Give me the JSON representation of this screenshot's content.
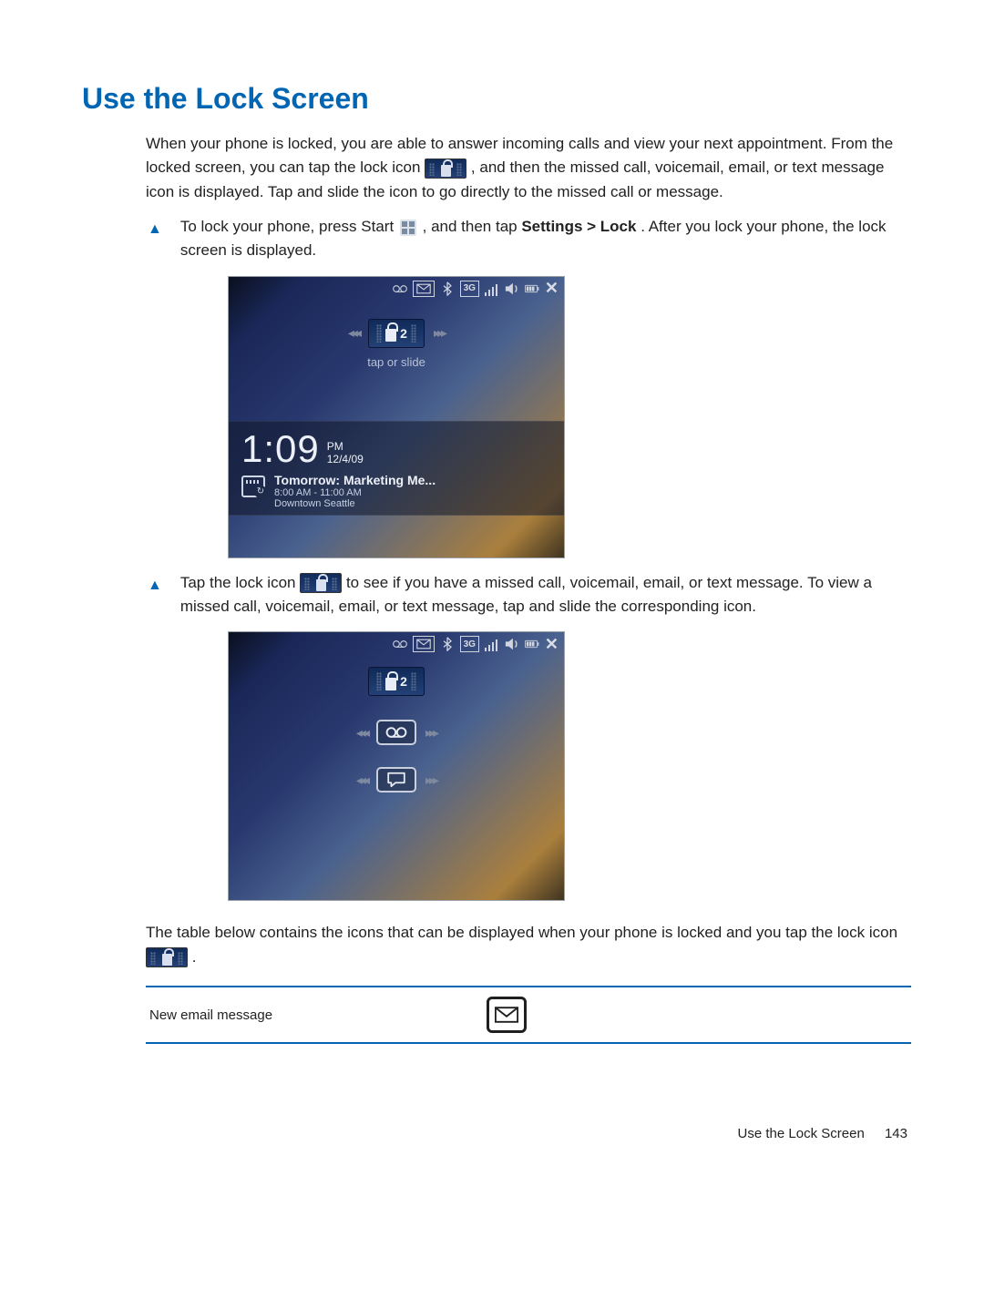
{
  "title": "Use the Lock Screen",
  "intro": {
    "p1a": "When your phone is locked, you are able to answer incoming calls and view your next appointment. From the locked screen, you can tap the lock icon ",
    "p1b": ", and then the missed call, voicemail, email, or text message icon is displayed. Tap and slide the icon to go directly to the missed call or message."
  },
  "step1": {
    "pre": "To lock your phone, press Start ",
    "mid": ", and then tap ",
    "bold": "Settings > Lock",
    "post": ". After you lock your phone, the lock screen is displayed."
  },
  "screenshot1": {
    "status_3g": "3G",
    "lock_badge": "2",
    "tap_hint": "tap or slide",
    "time": "1:09",
    "ampm": "PM",
    "date": "12/4/09",
    "appt_title": "Tomorrow: Marketing Me...",
    "appt_time": "8:00 AM - 11:00 AM",
    "appt_loc": "Downtown Seattle"
  },
  "step2": {
    "pre": "Tap the lock icon ",
    "post": " to see if you have a missed call, voicemail, email, or text message. To view a missed call, voicemail, email, or text message, tap and slide the corresponding icon."
  },
  "screenshot2": {
    "status_3g": "3G",
    "lock_badge": "2"
  },
  "table_intro": {
    "pre": "The table below contains the icons that can be displayed when your phone is locked and you tap the lock icon ",
    "post": "."
  },
  "table_row1_label": "New email message",
  "footer_title": "Use the Lock Screen",
  "page_number": "143"
}
